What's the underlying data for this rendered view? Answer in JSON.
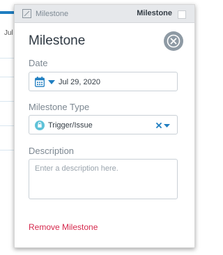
{
  "background": {
    "partial_text": "Jul"
  },
  "panel": {
    "header": {
      "icon": "milestone-icon",
      "title": "Milestone",
      "right_label": "Milestone"
    },
    "title": "Milestone",
    "close_icon": "close-icon",
    "date": {
      "label": "Date",
      "icon": "calendar-icon",
      "value": "Jul 29, 2020"
    },
    "milestone_type": {
      "label": "Milestone Type",
      "icon": "trigger-issue-icon",
      "value": "Trigger/Issue",
      "clear_icon": "clear-icon",
      "dropdown_icon": "chevron-down-icon"
    },
    "description": {
      "label": "Description",
      "placeholder": "Enter a description here."
    },
    "remove_label": "Remove Milestone"
  },
  "colors": {
    "accent_blue": "#1f7ec1",
    "remove_red": "#d5294d",
    "type_icon_teal": "#5fc2d8"
  }
}
